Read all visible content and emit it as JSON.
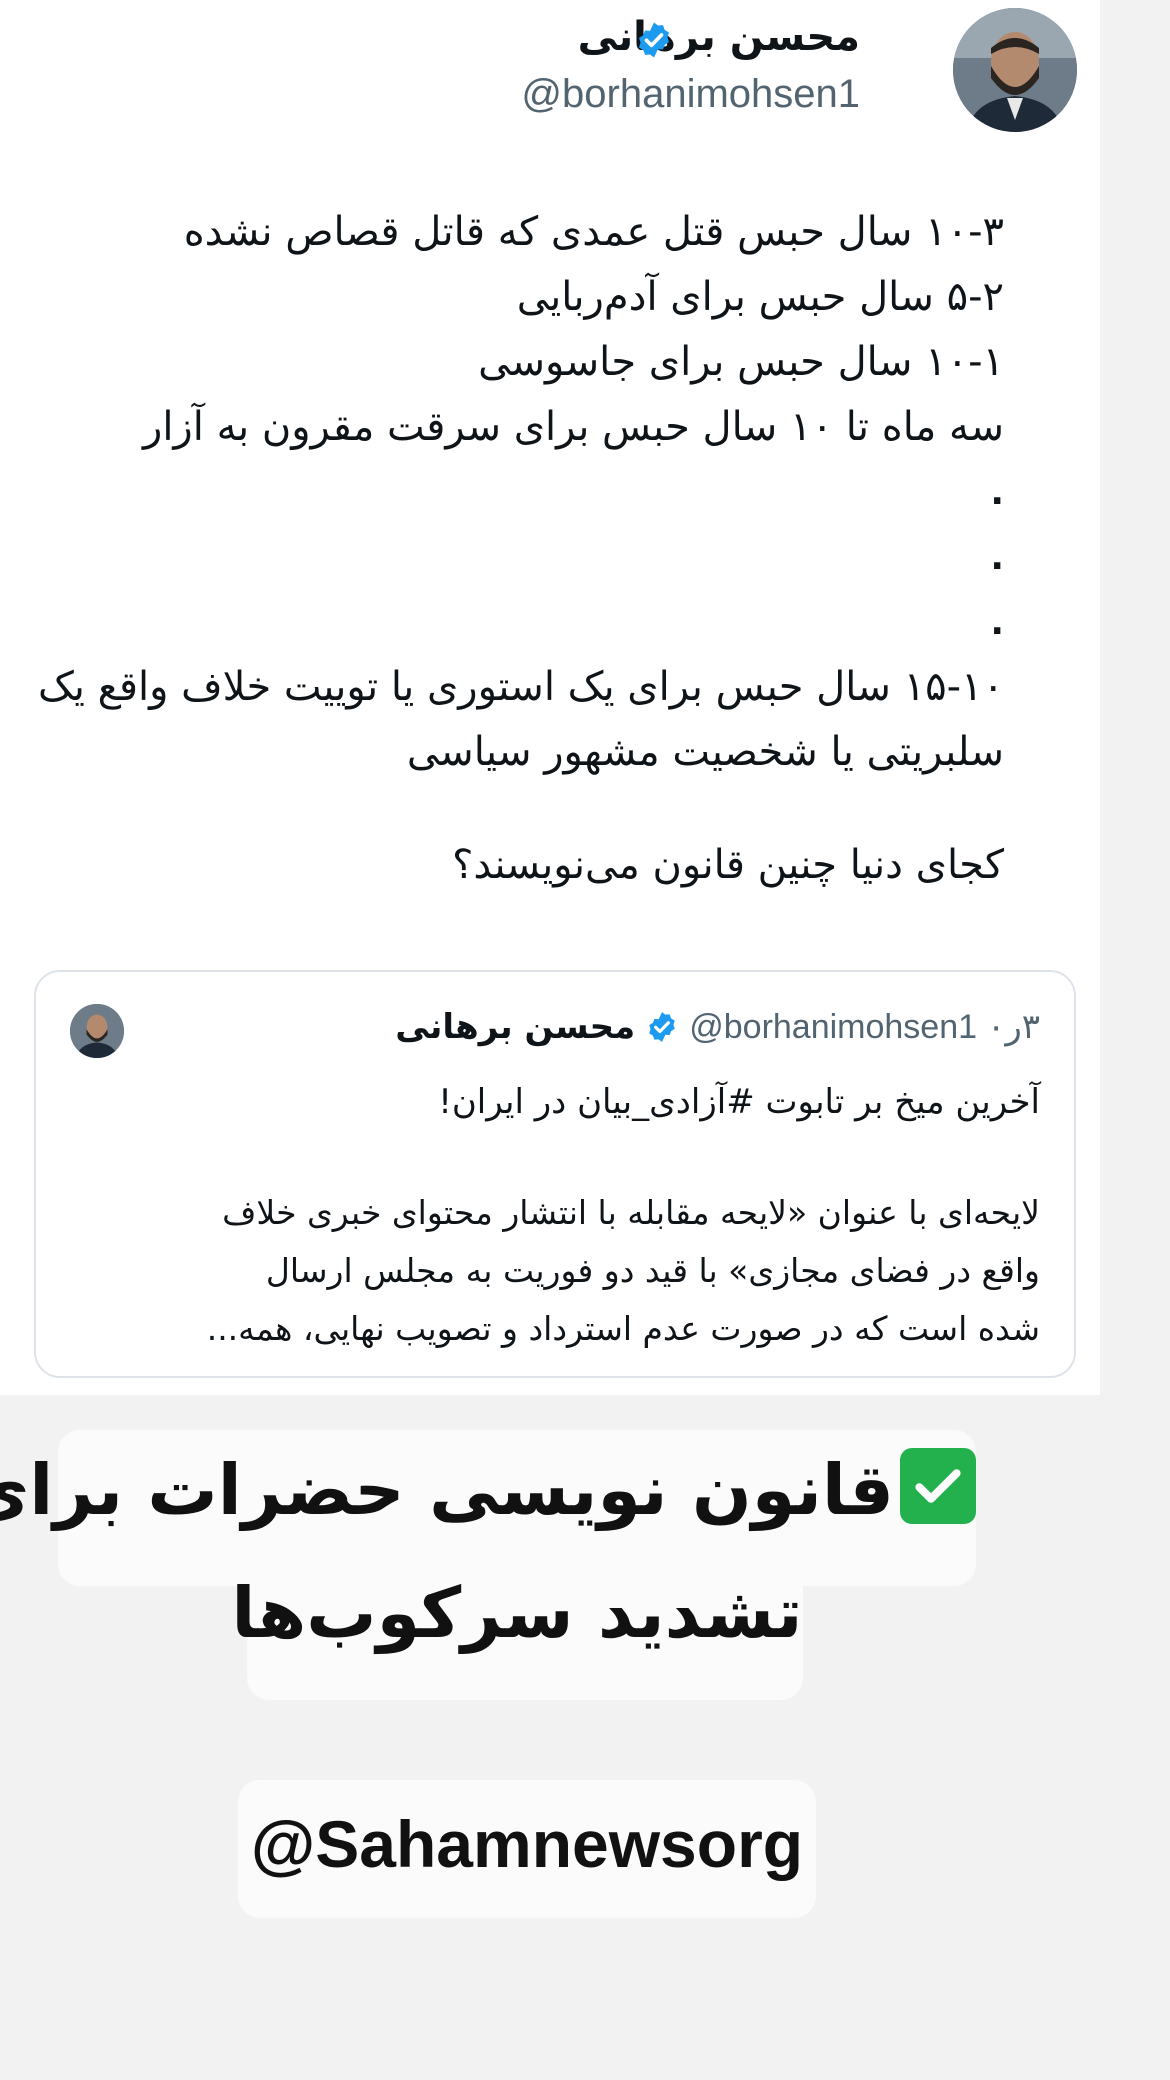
{
  "tweet": {
    "author_name": "محسن برهانی",
    "handle": "@borhanimohsen1",
    "lines": [
      "۱۰-۳ سال حبس قتل عمدی که قاتل قصاص نشده",
      "۵-۲ سال حبس برای آدم‌ربایی",
      "۱۰-۱ سال حبس برای جاسوسی",
      "سه ماه تا ۱۰ سال حبس برای سرقت مقرون به آزار",
      ".",
      ".",
      ".",
      "۱۵-۱۰ سال حبس برای یک استوری یا توییت خلاف واقع یک",
      "سلبریتی یا شخصیت مشهور سیاسی"
    ],
    "question": "کجای دنیا چنین قانون می‌نویسند؟"
  },
  "quoted_tweet": {
    "author_name": "محسن برهانی",
    "handle": "@borhanimohsen1",
    "time": "۳ر۰",
    "headline": "آخرین میخ بر تابوت #آزادی_بیان در ایران!",
    "body_lines": [
      "لایحه‌ای با عنوان «لایحه مقابله با انتشار محتوای خبری خلاف",
      "واقع در فضای مجازی» با قید دو فوریت به مجلس ارسال",
      "شده است که در صورت عدم استرداد و تصویب نهایی، همه..."
    ]
  },
  "overlay": {
    "caption_line1": "قانون نویسی حضرات برای",
    "caption_line2": "تشدید سرکوب‌ها",
    "check_icon": "check-mark-button-icon",
    "brand": "@Sahamnewsorg"
  },
  "colors": {
    "verified_blue": "#1d9bf0",
    "check_green": "#23b14d"
  }
}
